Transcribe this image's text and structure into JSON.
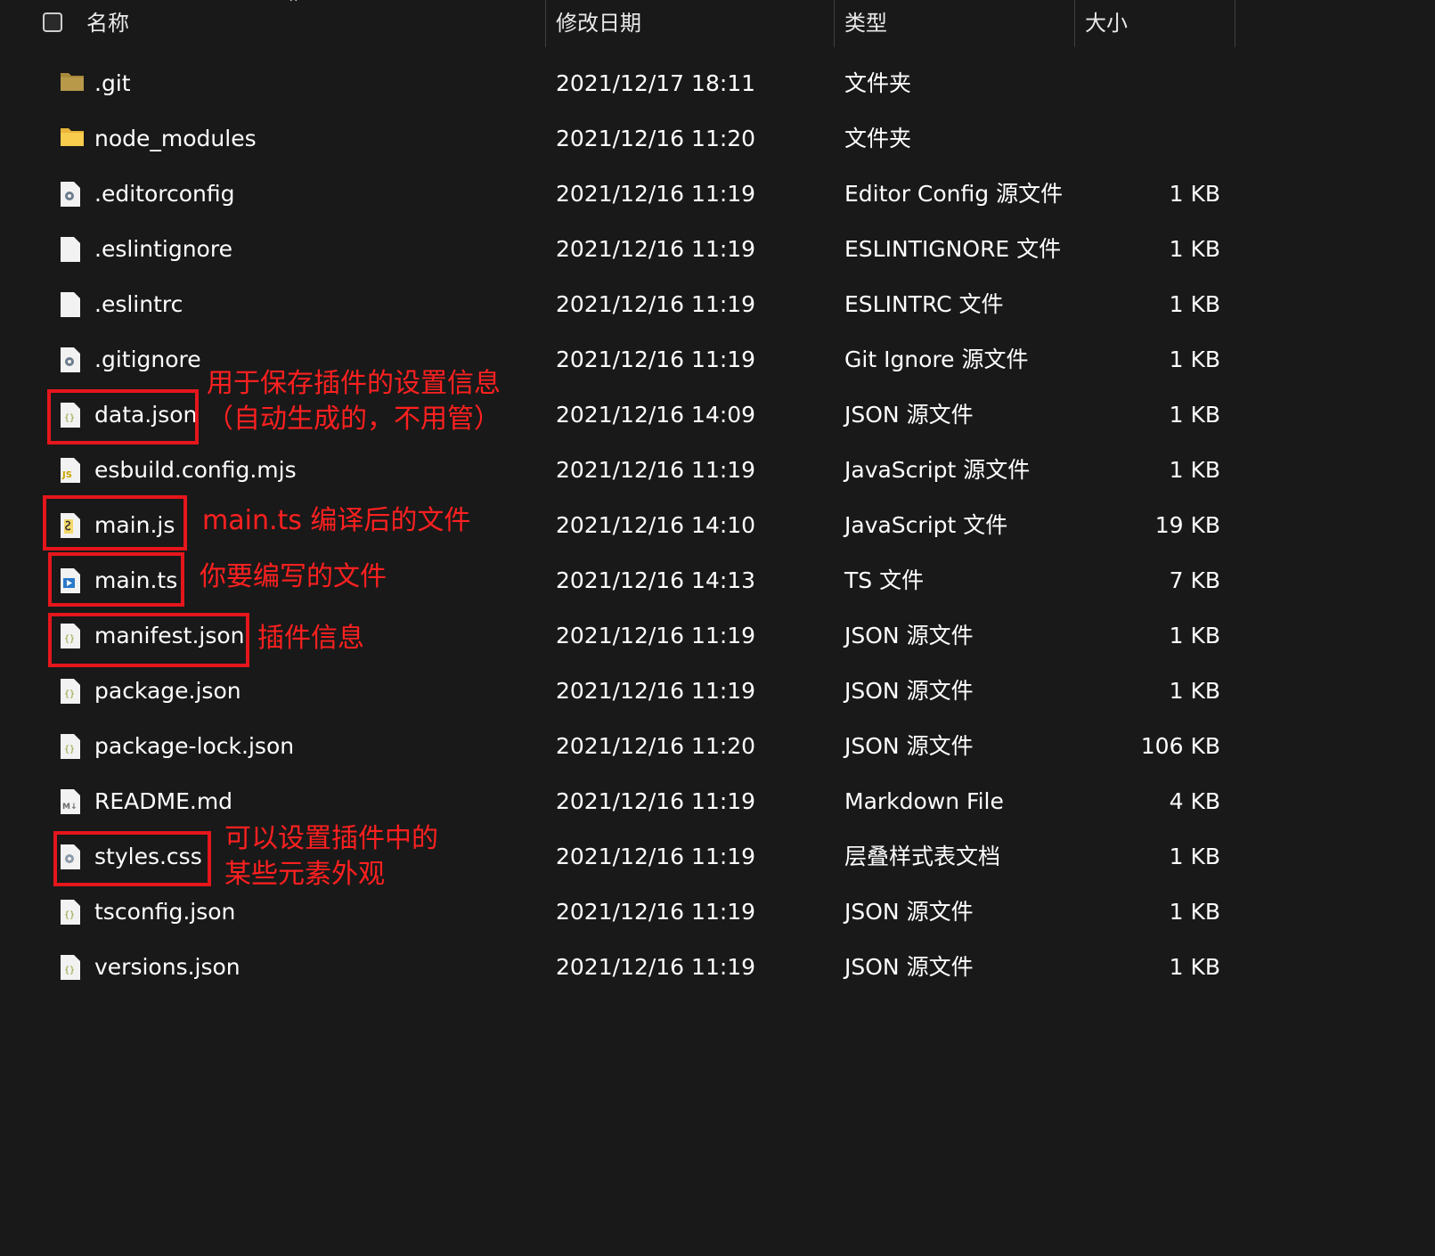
{
  "header": {
    "name": "名称",
    "date": "修改日期",
    "type": "类型",
    "size": "大小"
  },
  "files": [
    {
      "name": ".git",
      "date": "2021/12/17 18:11",
      "type": "文件夹",
      "size": "",
      "icon": "folder-dark-icon"
    },
    {
      "name": "node_modules",
      "date": "2021/12/16 11:20",
      "type": "文件夹",
      "size": "",
      "icon": "folder-icon"
    },
    {
      "name": ".editorconfig",
      "date": "2021/12/16 11:19",
      "type": "Editor Config 源文件",
      "size": "1 KB",
      "icon": "config-file-icon"
    },
    {
      "name": ".eslintignore",
      "date": "2021/12/16 11:19",
      "type": "ESLINTIGNORE 文件",
      "size": "1 KB",
      "icon": "blank-file-icon"
    },
    {
      "name": ".eslintrc",
      "date": "2021/12/16 11:19",
      "type": "ESLINTRC 文件",
      "size": "1 KB",
      "icon": "blank-file-icon"
    },
    {
      "name": ".gitignore",
      "date": "2021/12/16 11:19",
      "type": "Git Ignore 源文件",
      "size": "1 KB",
      "icon": "config-file-icon"
    },
    {
      "name": "data.json",
      "date": "2021/12/16 14:09",
      "type": "JSON 源文件",
      "size": "1 KB",
      "icon": "json-file-icon"
    },
    {
      "name": "esbuild.config.mjs",
      "date": "2021/12/16 11:19",
      "type": "JavaScript 源文件",
      "size": "1 KB",
      "icon": "js-file-icon"
    },
    {
      "name": "main.js",
      "date": "2021/12/16 14:10",
      "type": "JavaScript 文件",
      "size": "19 KB",
      "icon": "script-file-icon"
    },
    {
      "name": "main.ts",
      "date": "2021/12/16 14:13",
      "type": "TS 文件",
      "size": "7 KB",
      "icon": "ts-file-icon"
    },
    {
      "name": "manifest.json",
      "date": "2021/12/16 11:19",
      "type": "JSON 源文件",
      "size": "1 KB",
      "icon": "json-file-icon"
    },
    {
      "name": "package.json",
      "date": "2021/12/16 11:19",
      "type": "JSON 源文件",
      "size": "1 KB",
      "icon": "json-file-icon"
    },
    {
      "name": "package-lock.json",
      "date": "2021/12/16 11:20",
      "type": "JSON 源文件",
      "size": "106 KB",
      "icon": "json-file-icon"
    },
    {
      "name": "README.md",
      "date": "2021/12/16 11:19",
      "type": "Markdown File",
      "size": "4 KB",
      "icon": "markdown-file-icon"
    },
    {
      "name": "styles.css",
      "date": "2021/12/16 11:19",
      "type": "层叠样式表文档",
      "size": "1 KB",
      "icon": "css-file-icon"
    },
    {
      "name": "tsconfig.json",
      "date": "2021/12/16 11:19",
      "type": "JSON 源文件",
      "size": "1 KB",
      "icon": "json-file-icon"
    },
    {
      "name": "versions.json",
      "date": "2021/12/16 11:19",
      "type": "JSON 源文件",
      "size": "1 KB",
      "icon": "json-file-icon"
    }
  ],
  "annotations": {
    "data_json_line1": "用于保存插件的设置信息",
    "data_json_line2": "（自动生成的，不用管）",
    "main_js": "main.ts 编译后的文件",
    "main_ts": "你要编写的文件",
    "manifest_json": "插件信息",
    "styles_css_line1": "可以设置插件中的",
    "styles_css_line2": "某些元素外观"
  },
  "colors": {
    "background": "#191919",
    "highlight": "#e5161c",
    "annotation_text": "#ff2020",
    "folder": "#f4c542"
  }
}
